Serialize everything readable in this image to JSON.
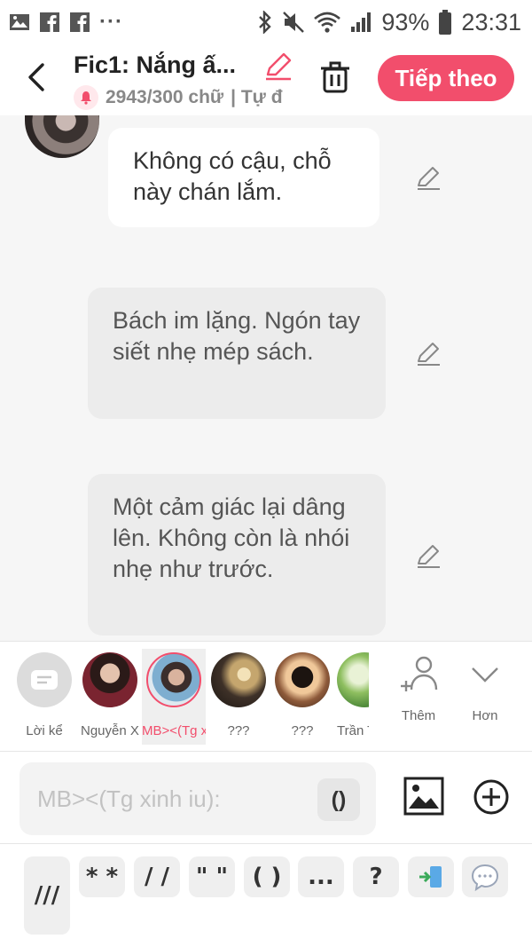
{
  "status_bar": {
    "battery": "93%",
    "time": "23:31",
    "left_icons": [
      "image-icon",
      "facebook-icon",
      "facebook-icon",
      "more-dots-icon"
    ],
    "right_icons": [
      "bluetooth-icon",
      "mute-icon",
      "wifi-icon",
      "signal-icon",
      "battery-icon"
    ],
    "more_dots": "···"
  },
  "header": {
    "title": "Fic1: Nắng ấ...",
    "word_count": "2943/300 chữ",
    "subtitle_extra": "| Tự đ",
    "next_label": "Tiếp theo",
    "accent_color": "#f24e6c"
  },
  "messages": [
    {
      "text": "Không có cậu, chỗ này chán lắm.",
      "style": "white"
    },
    {
      "text": "Bách im lặng. Ngón tay siết nhẹ mép sách.",
      "style": "grey"
    },
    {
      "text": "Một cảm giác lại dâng lên. Không còn là nhói nhẹ như trước.",
      "style": "grey"
    }
  ],
  "characters": [
    {
      "name": "Lời kể",
      "selected": false
    },
    {
      "name": "Nguyễn X...",
      "selected": false
    },
    {
      "name": "MB><(Tg x...",
      "selected": true
    },
    {
      "name": "???",
      "selected": false
    },
    {
      "name": "???",
      "selected": false
    },
    {
      "name": "Trần T",
      "selected": false
    }
  ],
  "tools": {
    "more_label": "Thêm",
    "expand_label": "Hơn"
  },
  "input": {
    "placeholder": "MB><(Tg xinh iu):",
    "paren_label": "()"
  },
  "shortcuts": [
    "///",
    "* *",
    "/ /",
    "\" \"",
    "( )",
    "...",
    "?"
  ]
}
